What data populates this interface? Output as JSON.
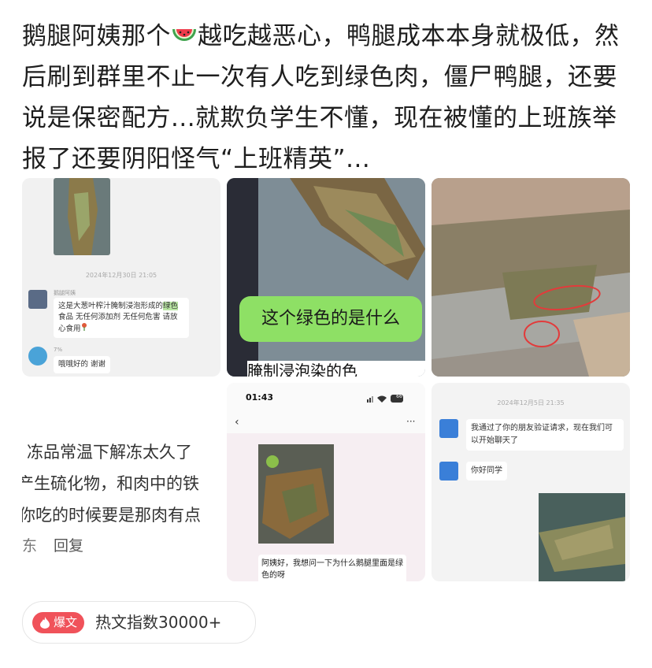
{
  "post": {
    "text_before_emoji": "鹅腿阿姨那个",
    "emoji": "watermelon-emoji",
    "text_after_emoji": "越吃越恶心，鸭腿成本本身就极低，然后刷到群里不止一次有人吃到绿色肉，僵尸鸭腿，还要说是保密配方...就欺负学生不懂，现在被懂的上班族举报了还要阴阳怪气“上班精英”..."
  },
  "images": {
    "img1": {
      "time": "2024年12月30日 21:05",
      "sender": "鹅腿阿姨",
      "msg_a": "这是大葱叶榨汁腌制浸泡形成的",
      "msg_hl": "绿色",
      "msg_b": "食品 无任何添加剂 无任何危害 请放心食用",
      "reply_name": "7%",
      "reply": "哦哦好的 谢谢"
    },
    "img2": {
      "caption": "这个绿色的是什么",
      "bottom_text": "腌制浸泡染的色"
    },
    "img4": {
      "line1": "冻品常温下解冻太久了",
      "line2": "产生硫化物，和肉中的铁",
      "line3": "你吃的时候要是那肉有点",
      "meta_left": "东",
      "reply_label": "回复"
    },
    "img5": {
      "status_time": "01:43",
      "battery": "66",
      "message": "阿姨好，我想问一下为什么鹅腿里面是绿色的呀"
    },
    "img6": {
      "time": "2024年12月5日 21:35",
      "msg1": "我通过了你的朋友验证请求，现在我们可以开始聊天了",
      "msg2": "你好同学"
    }
  },
  "badge": {
    "label": "爆文",
    "text": "热文指数30000+"
  },
  "colors": {
    "badge_red": "#f0525a",
    "banner_green": "#8ee065",
    "circle_red": "#e23b3b"
  }
}
